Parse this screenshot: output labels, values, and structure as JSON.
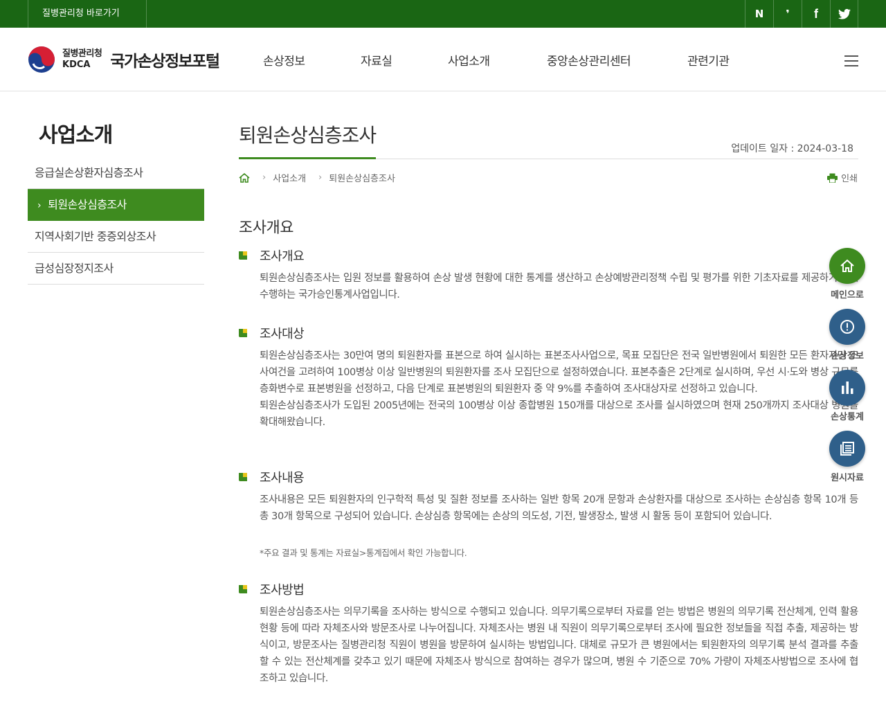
{
  "topbar": {
    "kdca_link": "질병관리청 바로가기",
    "sns": [
      {
        "label": "N",
        "icon": "naver-blog-icon"
      },
      {
        "label": "❜",
        "icon": "naver-post-icon"
      },
      {
        "label": "f",
        "icon": "facebook-icon"
      },
      {
        "label": "twitter",
        "icon": "twitter-icon"
      }
    ]
  },
  "header": {
    "org_name": "질병관리청",
    "org_abbr": "KDCA",
    "portal_name": "국가손상정보포털",
    "nav": [
      "손상정보",
      "자료실",
      "사업소개",
      "중앙손상관리센터",
      "관련기관"
    ]
  },
  "sidebar": {
    "title": "사업소개",
    "items": [
      {
        "label": "응급실손상환자심층조사",
        "active": false
      },
      {
        "label": "퇴원손상심층조사",
        "active": true
      },
      {
        "label": "지역사회기반 중증외상조사",
        "active": false
      },
      {
        "label": "급성심장정지조사",
        "active": false
      }
    ]
  },
  "content": {
    "page_title": "퇴원손상심층조사",
    "update": "업데이트 일자 : 2024-03-18",
    "breadcrumb": [
      "사업소개",
      "퇴원손상심층조사"
    ],
    "print_label": "인쇄",
    "h2": "조사개요",
    "sections": [
      {
        "title": "조사개요",
        "body": "퇴원손상심층조사는 입원 정보를 활용하여 손상 발생 현황에 대한 통계를 생산하고 손상예방관리정책 수립 및 평가를 위한 기초자료를 제공하기 위해 수행하는 국가승인통계사업입니다."
      },
      {
        "title": "조사대상",
        "body": " 퇴원손상심층조사는 30만여 명의 퇴원환자를 표본으로 하여 실시하는 표본조사사업으로, 목표 모집단은 전국 일반병원에서 퇴원한 모든 환자지만 조사여건을 고려하여 100병상 이상 일반병원의 퇴원환자를 조사 모집단으로 설정하였습니다. 표본추출은 2단계로 실시하며, 우선 시·도와 병상 규모를 층화변수로 표본병원을 선정하고, 다음 단계로 표본병원의 퇴원환자 중 약 9%를 추출하여 조사대상자로 선정하고 있습니다.\n 퇴원손상심층조사가 도입된 2005년에는 전국의 100병상 이상 종합병원 150개를 대상으로 조사를 실시하였으며 현재 250개까지 조사대상 병원을 확대해왔습니다."
      },
      {
        "title": "조사내용",
        "body": " 조사내용은 모든 퇴원환자의 인구학적 특성 및 질환 정보를 조사하는 일반 항목 20개 문항과 손상환자를 대상으로 조사하는 손상심층 항목 10개 등 총 30개 항목으로 구성되어 있습니다. 손상심층 항목에는 손상의 의도성, 기전, 발생장소, 발생 시 활동 등이 포함되어 있습니다.",
        "note": "*주요 결과 및 통계는 자료실>통계집에서 확인 가능합니다."
      },
      {
        "title": "조사방법",
        "body": " 퇴원손상심층조사는 의무기록을 조사하는 방식으로 수행되고 있습니다. 의무기록으로부터 자료를 얻는 방법은 병원의 의무기록 전산체계, 인력 활용 현황 등에 따라 자체조사와 방문조사로 나누어집니다. 자체조사는 병원 내 직원이 의무기록으로부터 조사에 필요한 정보들을 직접 추출, 제공하는 방식이고, 방문조사는 질병관리청 직원이 병원을 방문하여 실시하는 방법입니다. 대체로 규모가 큰 병원에서는 퇴원환자의 의무기록 분석 결과를 추출할 수 있는 전산체계를 갖추고 있기 때문에 자체조사 방식으로 참여하는 경우가 많으며, 병원 수 기준으로 70% 가량이 자체조사방법으로 조사에 협조하고 있습니다."
      }
    ]
  },
  "quick_menu": [
    {
      "label": "메인으로",
      "icon": "home-icon",
      "color": "#3e8b1f"
    },
    {
      "label": "손상정보",
      "icon": "info-icon",
      "color": "#2f5f8a"
    },
    {
      "label": "손상통계",
      "icon": "bar-chart-icon",
      "color": "#2f5f8a"
    },
    {
      "label": "원시자료",
      "icon": "document-icon",
      "color": "#2f5f8a"
    }
  ],
  "colors": {
    "brand_green": "#1a6614",
    "accent_green": "#3e8b1f",
    "navy": "#2f5f8a",
    "bullet_yellow": "#e8c51a"
  }
}
